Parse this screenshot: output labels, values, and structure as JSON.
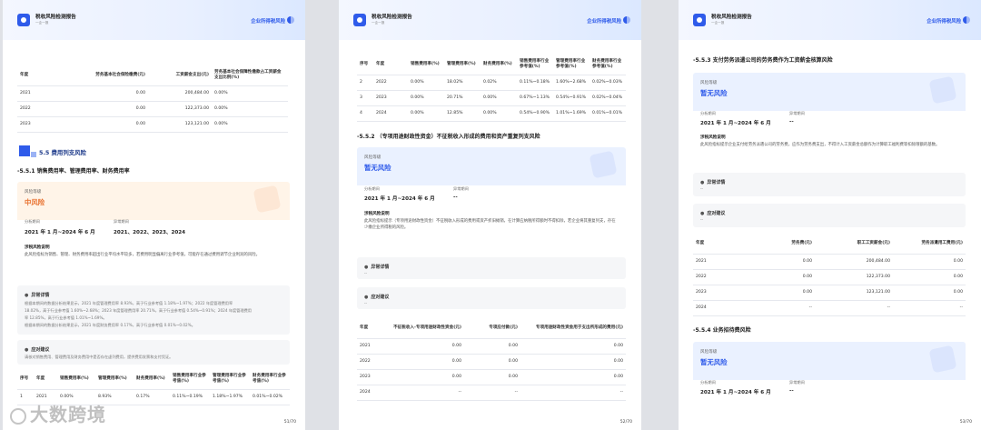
{
  "header": {
    "title": "税收风险检测报告",
    "subtitle": "一企一报",
    "section": "企业所得税风险"
  },
  "page1": {
    "table1": {
      "headers": [
        "年度",
        "劳务基本社会保险缴费(元)",
        "工资薪金支出(元)",
        "劳务基本社会保障性缴款占工资薪金支出比例(%)"
      ],
      "rows": [
        [
          "2021",
          "0.00",
          "200,484.00",
          "0.00%"
        ],
        [
          "2022",
          "0.00",
          "122,373.00",
          "0.00%"
        ],
        [
          "2023",
          "0.00",
          "123,121.00",
          "0.00%"
        ]
      ]
    },
    "section_title": "5.5 费用列支风险",
    "sub_title": "-5.5.1 销售费用率、管理费用率、财务费用率",
    "risk": {
      "label": "风险等级",
      "value": "中风险",
      "period_label": "分析期间",
      "period": "2021 年 1 月~2024 年 6 月",
      "abnormal_label": "异常期间",
      "abnormal": "2021、2022、2023、2024"
    },
    "desc": {
      "title": "涉税风险说明",
      "text": "此风险指标为销售、管理、财务费用率超出行业平均水平较多，若费用明显偏离行业参考值，可能存在通过费用调节企业利润的风险。"
    },
    "detail": {
      "title": "异常详情",
      "lines": [
        "根据本期间的数据分析结果显示，2021 年度管理费用率 8.93%，高于行业参考值 1.18%~1.97%；2022 年度管理费用率",
        "18.02%，高于行业参考值 1.60%~2.68%；2023 年度管理费用率 20.71%，高于行业参考值 0.54%~0.91%；2024 年度管理费用",
        "率 12.85%，高于行业参考值 1.01%~1.69%。",
        "根据本期间的数据分析结果显示，2021 年度财务费用率 0.17%，高于行业参考值 0.01%~0.02%。"
      ]
    },
    "advice": {
      "title": "应对建议",
      "text": "请核对销售费用、管理费用及财务费用中是否存在虚列费用，提供费用发票和支付凭证。"
    },
    "table2": {
      "headers": [
        "序号",
        "年度",
        "销售费用率(%)",
        "管理费用率(%)",
        "财务费用率(%)",
        "销售费用率行业参考值(%)",
        "管理费用率行业参考值(%)",
        "财务费用率行业参考值(%)"
      ],
      "rows": [
        [
          "1",
          "2021",
          "0.00%",
          "8.93%",
          "0.17%",
          "0.11%~0.19%",
          "1.18%~1.97%",
          "0.01%~0.02%"
        ]
      ]
    },
    "page_num": "51/70"
  },
  "page2": {
    "table1": {
      "headers": [
        "序号",
        "年度",
        "销售费用率(%)",
        "管理费用率(%)",
        "财务费用率(%)",
        "销售费用率行业参考值(%)",
        "管理费用率行业参考值(%)",
        "财务费用率行业参考值(%)"
      ],
      "rows": [
        [
          "2",
          "2022",
          "0.00%",
          "18.02%",
          "0.02%",
          "0.11%~0.18%",
          "1.60%~2.68%",
          "0.02%~0.03%"
        ],
        [
          "3",
          "2023",
          "0.00%",
          "20.71%",
          "0.00%",
          "0.67%~1.13%",
          "0.54%~0.91%",
          "0.02%~0.04%"
        ],
        [
          "4",
          "2024",
          "0.00%",
          "12.85%",
          "0.00%",
          "0.54%~0.90%",
          "1.01%~1.69%",
          "0.01%~0.01%"
        ]
      ]
    },
    "sub_title": "-5.5.2 （专项用途财政性资金）不征税收入形成的费用和资产重复列支风险",
    "risk": {
      "label": "风险等级",
      "value": "暂无风险",
      "period_label": "分析期间",
      "period": "2021 年 1 月~2024 年 6 月",
      "abnormal_label": "异常期间",
      "abnormal": "--"
    },
    "desc": {
      "title": "涉税风险说明",
      "text": "此风险指标提示（专项用途财政性资金）不征税收入形成的费用或资产折旧摊销，在计算应纳税所得额时不得扣除，若企业将其重复列支，存在少缴企业所得税的风险。"
    },
    "detail": {
      "title": "异常详情",
      "text": "--"
    },
    "advice": {
      "title": "应对建议",
      "text": "--"
    },
    "table2": {
      "headers": [
        "年度",
        "不征税收入-专项用途财政性资金(元)",
        "专项应付款(元)",
        "专项用途财政性资金用于支出所形成的费用(元)"
      ],
      "rows": [
        [
          "2021",
          "0.00",
          "0.00",
          "0.00"
        ],
        [
          "2022",
          "0.00",
          "0.00",
          "0.00"
        ],
        [
          "2023",
          "0.00",
          "0.00",
          "0.00"
        ],
        [
          "2024",
          "--",
          "--",
          "--"
        ]
      ]
    },
    "page_num": "52/70"
  },
  "page3": {
    "sub_title": "-5.5.3 支付劳务派遣公司的劳务费作为工资薪金核算风险",
    "risk": {
      "label": "风险等级",
      "value": "暂无风险",
      "period_label": "分析期间",
      "period": "2021 年 1 月~2024 年 6 月",
      "abnormal_label": "异常期间",
      "abnormal": "--"
    },
    "desc": {
      "title": "涉税风险说明",
      "text": "此风险指标提示企业支付给劳务派遣公司的劳务费，应作为劳务费支出，不得计入工资薪金总额作为计算职工福利费等扣除限额的基数。"
    },
    "detail": {
      "title": "异常详情",
      "text": "--"
    },
    "advice": {
      "title": "应对建议",
      "text": "--"
    },
    "table": {
      "headers": [
        "年度",
        "劳务费(元)",
        "职工工资薪金(元)",
        "劳务派遣用工费用(元)"
      ],
      "rows": [
        [
          "2021",
          "0.00",
          "200,484.00",
          "0.00"
        ],
        [
          "2022",
          "0.00",
          "122,373.00",
          "0.00"
        ],
        [
          "2023",
          "0.00",
          "123,121.00",
          "0.00"
        ],
        [
          "2024",
          "--",
          "--",
          "--"
        ]
      ]
    },
    "sub_title2": "-5.5.4 业务招待费风险",
    "risk2": {
      "label": "风险等级",
      "value": "暂无风险",
      "period_label": "分析期间",
      "period": "2021 年 1 月~2024 年 6 月",
      "abnormal_label": "异常期间",
      "abnormal": "--"
    },
    "page_num": "53/70"
  },
  "watermark": "大数跨境"
}
